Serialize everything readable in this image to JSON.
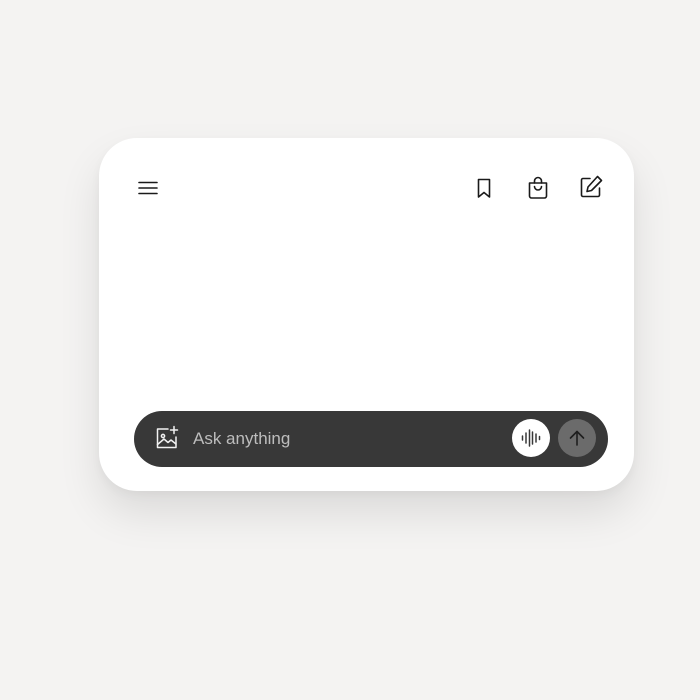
{
  "header": {
    "menu_icon": "hamburger-menu-icon",
    "bookmark_icon": "bookmark-icon",
    "bag_icon": "shopping-bag-icon",
    "compose_icon": "new-chat-compose-icon"
  },
  "composer": {
    "placeholder": "Ask anything",
    "value": "",
    "attach_icon": "add-image-icon",
    "voice_icon": "voice-waveform-icon",
    "send_icon": "arrow-up-icon"
  },
  "colors": {
    "page_background": "#f4f3f2",
    "card_background": "#ffffff",
    "composer_background": "#383838",
    "voice_button": "#ffffff",
    "send_button": "#6b6b6b",
    "icon_dark": "#1a1a1a"
  }
}
